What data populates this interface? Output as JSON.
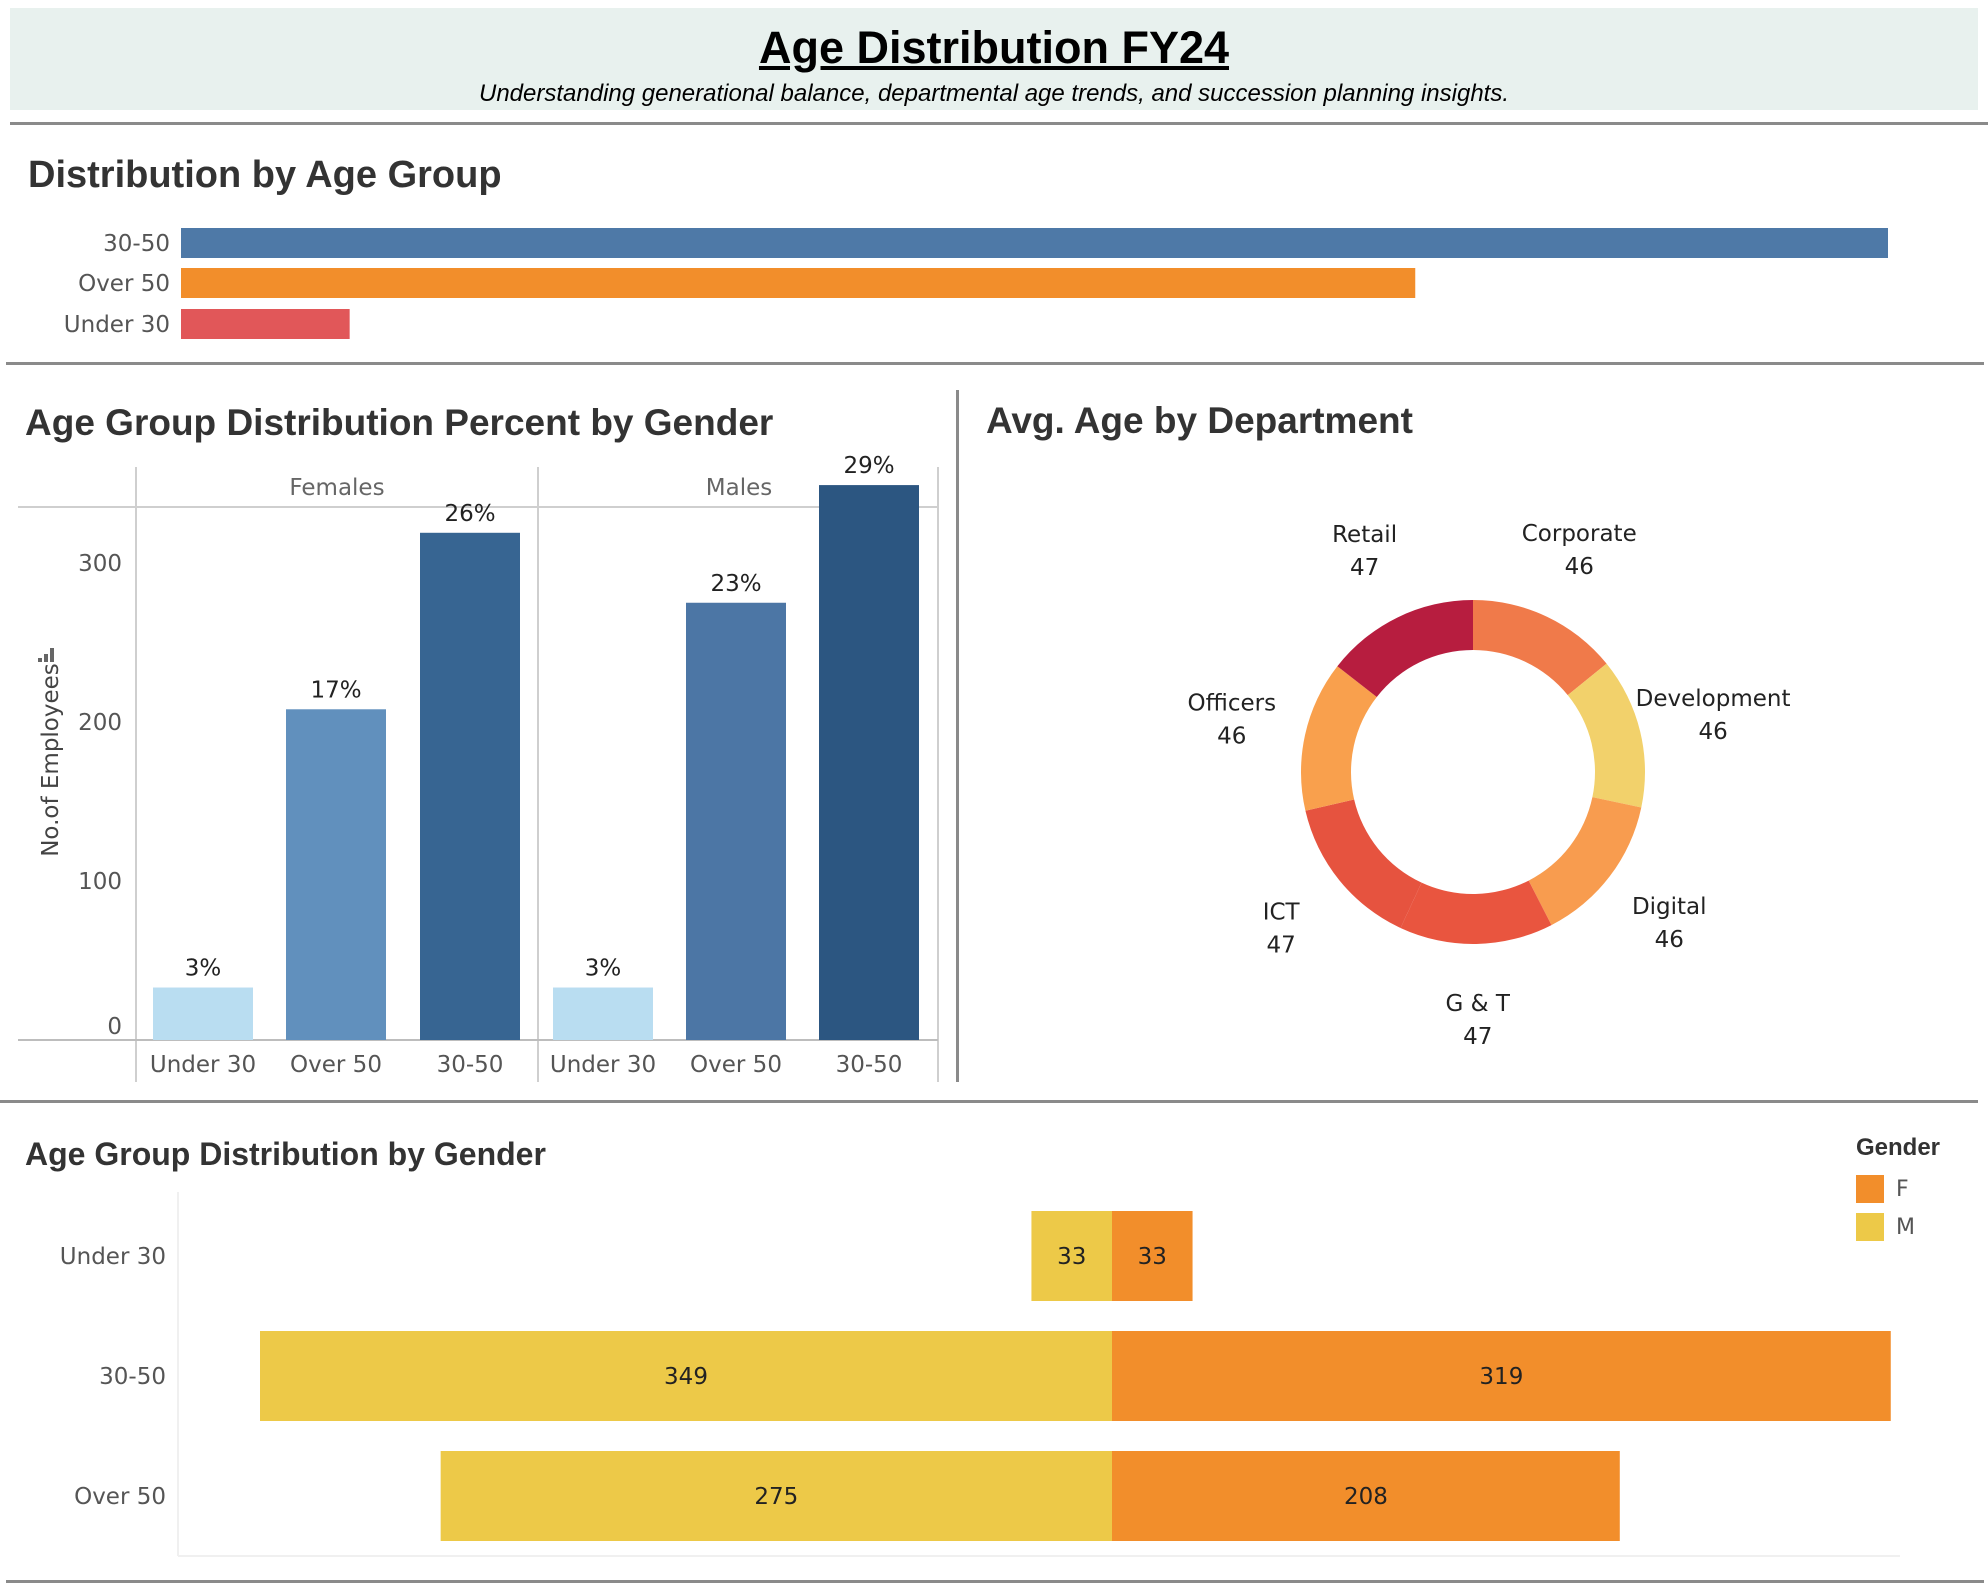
{
  "header": {
    "title": "Age Distribution FY24",
    "subtitle": "Understanding generational balance, departmental age trends, and succession planning insights."
  },
  "colors": {
    "under30_red": "#e15759",
    "over50_orange": "#f28e2b",
    "age30_50_blue": "#4e79a7",
    "female_orange": "#f28e2b",
    "male_yellow": "#edc948"
  },
  "chart_data": [
    {
      "type": "bar",
      "title": "Distribution by Age Group",
      "orientation": "horizontal",
      "categories": [
        "30-50",
        "Over 50",
        "Under 30"
      ],
      "values": [
        668,
        483,
        66
      ],
      "colors": [
        "#4e79a7",
        "#f28e2b",
        "#e15759"
      ],
      "xlim": [
        0,
        700
      ]
    },
    {
      "type": "bar",
      "title": "Age Group Distribution Percent by Gender",
      "ylabel": "No.of Employees",
      "ylim": [
        0,
        380
      ],
      "yticks": [
        0,
        100,
        200,
        300
      ],
      "panels": [
        {
          "name": "Females",
          "categories": [
            "Under 30",
            "Over 50",
            "30-50"
          ],
          "values": [
            33,
            208,
            319
          ],
          "labels": [
            "3%",
            "17%",
            "26%"
          ],
          "colors": [
            "#b9ddf1",
            "#6190bd",
            "#376592"
          ]
        },
        {
          "name": "Males",
          "categories": [
            "Under 30",
            "Over 50",
            "30-50"
          ],
          "values": [
            33,
            275,
            349
          ],
          "labels": [
            "3%",
            "23%",
            "29%"
          ],
          "colors": [
            "#b9ddf1",
            "#4c76a5",
            "#2c5681"
          ]
        }
      ]
    },
    {
      "type": "pie",
      "title": "Avg. Age by Department",
      "donut": true,
      "slices": [
        {
          "name": "Corporate",
          "value": 46,
          "color": "#f07a4a"
        },
        {
          "name": "Development",
          "value": 46,
          "color": "#f2d16b"
        },
        {
          "name": "Digital",
          "value": 46,
          "color": "#f89c4f"
        },
        {
          "name": "G & T",
          "value": 47,
          "color": "#e9553f"
        },
        {
          "name": "ICT",
          "value": 47,
          "color": "#e6533f"
        },
        {
          "name": "Officers",
          "value": 46,
          "color": "#f9a04d"
        },
        {
          "name": "Retail",
          "value": 47,
          "color": "#b71d3f"
        }
      ]
    },
    {
      "type": "bar",
      "title": "Age Group Distribution by Gender",
      "orientation": "horizontal-diverging",
      "categories": [
        "Under 30",
        "30-50",
        "Over 50"
      ],
      "series": [
        {
          "name": "M",
          "values": [
            33,
            349,
            275
          ],
          "color": "#edc948"
        },
        {
          "name": "F",
          "values": [
            33,
            319,
            208
          ],
          "color": "#f28e2b"
        }
      ],
      "legend": {
        "title": "Gender",
        "items": [
          "F",
          "M"
        ],
        "position": "top-right"
      }
    }
  ]
}
